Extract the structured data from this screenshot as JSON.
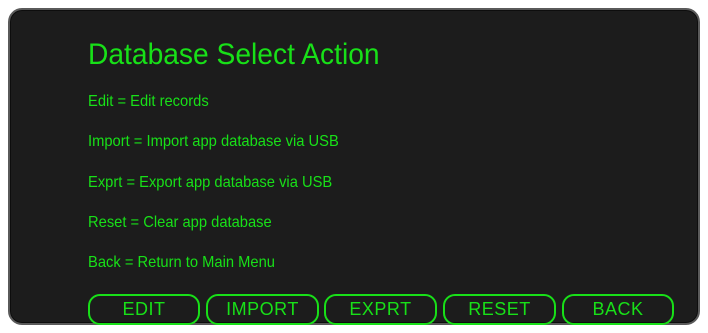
{
  "screen": {
    "title": "Database Select Action",
    "lines": [
      "Edit = Edit records",
      "Import = Import app database via USB",
      "Exprt = Export app database via USB",
      "Reset = Clear app database",
      "Back = Return to Main Menu"
    ]
  },
  "buttons": {
    "edit": "EDIT",
    "import": "IMPORT",
    "exprt": "EXPRT",
    "reset": "RESET",
    "back": "BACK"
  },
  "colors": {
    "text": "#18e018",
    "background": "#1c1c1c",
    "border": "#5a5a5a"
  }
}
